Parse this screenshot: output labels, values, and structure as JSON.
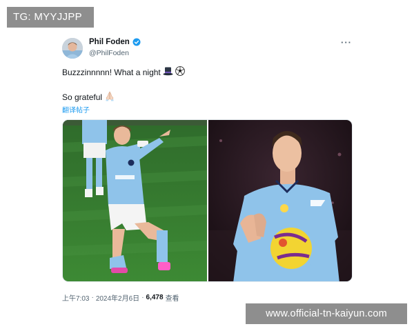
{
  "watermarks": {
    "top_left": "TG: MYYJJPP",
    "bottom_right": "www.official-tn-kaiyun.com"
  },
  "tweet": {
    "display_name": "Phil Foden",
    "handle": "@PhilFoden",
    "verified": true,
    "more_icon": "more-horizontal-icon",
    "text_line1": "Buzzzinnnnn! What a night",
    "text_line1_emojis": [
      "top-hat",
      "soccer-ball"
    ],
    "text_line2": "So grateful",
    "text_line2_emojis": [
      "praying-hands"
    ],
    "translate_link": "翻译帖子",
    "meta": {
      "time": "上午7:03",
      "separator": "·",
      "date": "2024年2月6日",
      "views_count": "6,478",
      "views_label": "查看"
    }
  },
  "colors": {
    "link": "#1d9bf0",
    "verified": "#1d9bf0",
    "secondary_text": "#536471",
    "kit_sky_blue": "#8fc3ea",
    "watermark_bg": "#8e8e8e"
  }
}
